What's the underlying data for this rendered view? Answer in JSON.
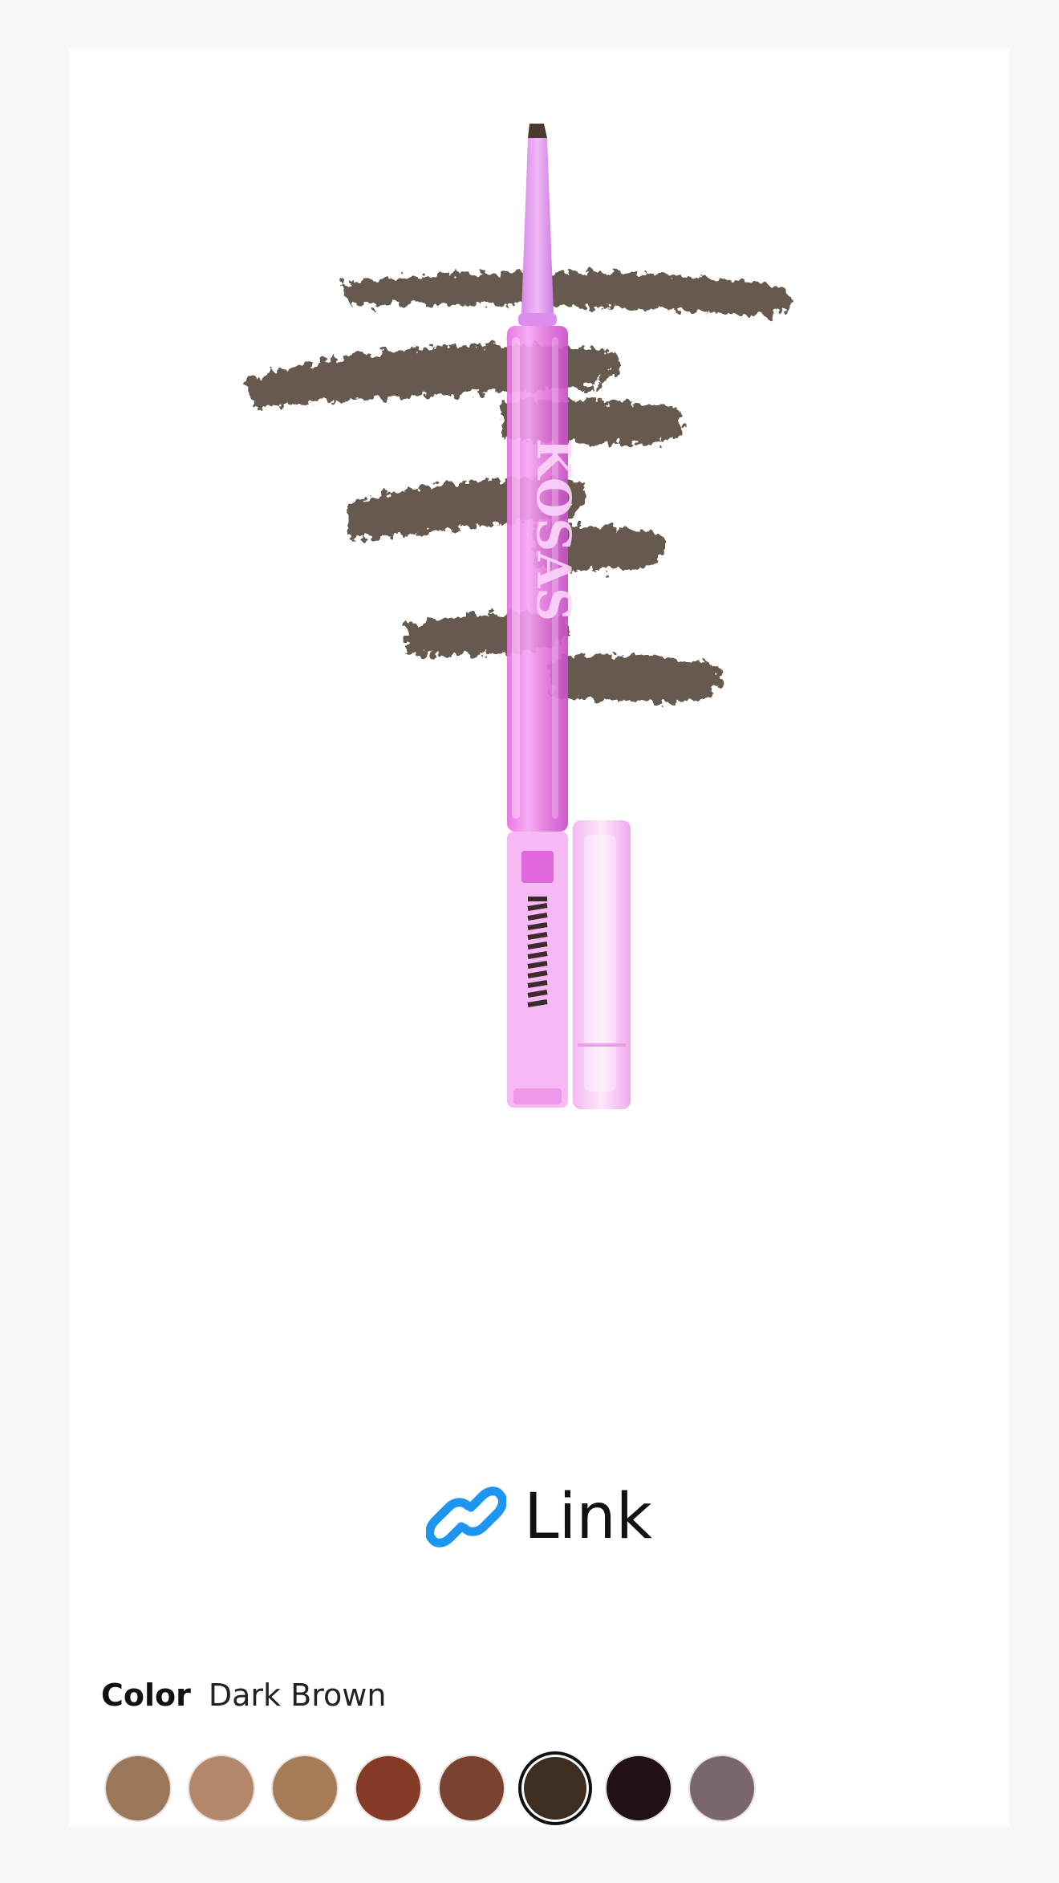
{
  "product": {
    "image_alt": "Brow pencil",
    "brand_lettering": "KOSAS"
  },
  "link": {
    "label": "Link",
    "icon": "link-icon",
    "icon_color": "#1d96f2"
  },
  "color_selector": {
    "title": "Color",
    "selected_name": "Dark Brown",
    "selected_index": 5,
    "swatches": [
      {
        "hex": "#9b7759"
      },
      {
        "hex": "#b3876a"
      },
      {
        "hex": "#a67c58"
      },
      {
        "hex": "#843a25"
      },
      {
        "hex": "#7a4331"
      },
      {
        "hex": "#3e2e22"
      },
      {
        "hex": "#1f1116"
      },
      {
        "hex": "#7a676b"
      }
    ]
  }
}
